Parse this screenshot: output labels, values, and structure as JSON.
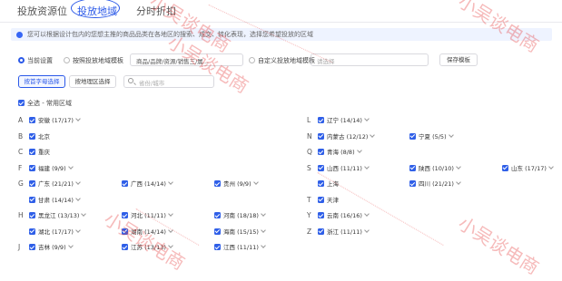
{
  "tabs": [
    {
      "label": "投放资源位",
      "active": false
    },
    {
      "label": "投放地域",
      "active": true
    },
    {
      "label": "分时折扣",
      "active": false
    }
  ],
  "notice": "您可以根据设计包内的您想主推的商品品类在各地区的搜索、成交、转化表现，选择您希望投放的区域",
  "settings": {
    "current": "当前设置",
    "industry_template": "按照投放地域模板",
    "industry_select": "商品/品牌/资源/销售三/属...",
    "custom_template": "自定义投放地域模板",
    "custom_select_placeholder": "请选择",
    "save_button": "保存模板"
  },
  "filter": {
    "by_letter": "按首字母选择",
    "by_region": "按地理区选择",
    "search_placeholder": "省份/城市"
  },
  "select_all": "全选 - 常用区域",
  "left_groups": [
    {
      "letter": "A",
      "rows": [
        [
          "安徽 (17/17)"
        ]
      ]
    },
    {
      "letter": "B",
      "rows": [
        [
          "北京"
        ]
      ]
    },
    {
      "letter": "C",
      "rows": [
        [
          "重庆"
        ]
      ]
    },
    {
      "letter": "F",
      "rows": [
        [
          "福建 (9/9)"
        ]
      ]
    },
    {
      "letter": "G",
      "rows": [
        [
          "广东 (21/21)",
          "广西 (14/14)",
          "贵州 (9/9)"
        ],
        [
          "甘肃 (14/14)"
        ]
      ]
    },
    {
      "letter": "H",
      "rows": [
        [
          "黑龙江 (13/13)",
          "河北 (11/11)",
          "河南 (18/18)"
        ],
        [
          "湖北 (17/17)",
          "湖南 (14/14)",
          "海南 (15/15)"
        ]
      ]
    },
    {
      "letter": "J",
      "rows": [
        [
          "吉林 (9/9)",
          "江苏 (13/13)",
          "江西 (11/11)"
        ]
      ]
    }
  ],
  "right_groups": [
    {
      "letter": "L",
      "rows": [
        [
          "辽宁 (14/14)"
        ]
      ]
    },
    {
      "letter": "N",
      "rows": [
        [
          "内蒙古 (12/12)",
          "宁夏 (5/5)"
        ]
      ]
    },
    {
      "letter": "Q",
      "rows": [
        [
          "青海 (8/8)"
        ]
      ]
    },
    {
      "letter": "S",
      "rows": [
        [
          "山西 (11/11)",
          "陕西 (10/10)",
          "山东 (17/17)"
        ],
        [
          "上海",
          "四川 (21/21)"
        ]
      ]
    },
    {
      "letter": "T",
      "rows": [
        [
          "天津"
        ]
      ]
    },
    {
      "letter": "Y",
      "rows": [
        [
          "云南 (16/16)"
        ]
      ]
    },
    {
      "letter": "Z",
      "rows": [
        [
          "浙江 (11/11)"
        ]
      ]
    }
  ],
  "watermark": "小吴谈电商",
  "colors": {
    "accent": "#2b59e8",
    "checkbox": "#2f5fe8",
    "watermark": "#e63c3c"
  }
}
